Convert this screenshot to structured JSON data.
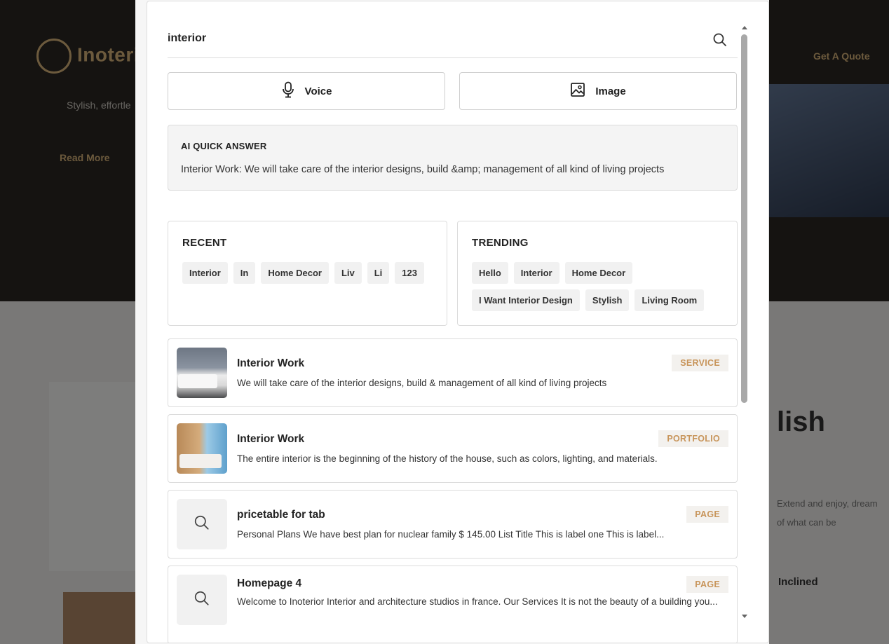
{
  "background_page": {
    "logo_text": "Inoteri",
    "hero_subtitle": "Stylish, effortle",
    "hero_button": "Read More",
    "header_cta": "Get A Quote",
    "section_heading": "lish",
    "section_text": "Extend and enjoy, dream of what can be",
    "section_label": "Inclined"
  },
  "search": {
    "query": "interior",
    "placeholder": "",
    "icon": "search-icon"
  },
  "modes": {
    "voice_label": "Voice",
    "image_label": "Image"
  },
  "ai_quick_answer": {
    "title": "AI QUICK ANSWER",
    "text": "Interior Work: We will take care of the interior designs, build &amp; management of all kind of living projects"
  },
  "recent": {
    "title": "RECENT",
    "tags": [
      "Interior",
      "In",
      "Home Decor",
      "Liv",
      "Li",
      "123"
    ]
  },
  "trending": {
    "title": "TRENDING",
    "tags": [
      "Hello",
      "Interior",
      "Home Decor",
      "I Want Interior Design",
      "Stylish",
      "Living Room"
    ]
  },
  "results": [
    {
      "title": "Interior Work",
      "badge": "SERVICE",
      "desc": "We will take care of the interior designs, build & management of all kind of living projects",
      "thumb": "bedroom-photo"
    },
    {
      "title": "Interior Work",
      "badge": "PORTFOLIO",
      "desc": "The entire interior is the beginning of the history of the house, such as colors, lighting, and materials.",
      "thumb": "bedroom-photo"
    },
    {
      "title": "pricetable for tab",
      "badge": "PAGE",
      "desc": "Personal Plans We have best plan for nuclear family $ 145.00 List Title This is label one This is label...",
      "thumb": "search-icon"
    },
    {
      "title": "Homepage 4",
      "badge": "PAGE",
      "desc": "Welcome to Inoterior Interior and architecture studios in france. Our Services It is not the beauty of a building you...",
      "thumb": "search-icon"
    }
  ],
  "colors": {
    "badge_text": "#c8955b",
    "badge_bg": "#f3f1ee",
    "tag_bg": "#f1f1f1",
    "overlay": "rgba(0,0,0,0.5)"
  }
}
